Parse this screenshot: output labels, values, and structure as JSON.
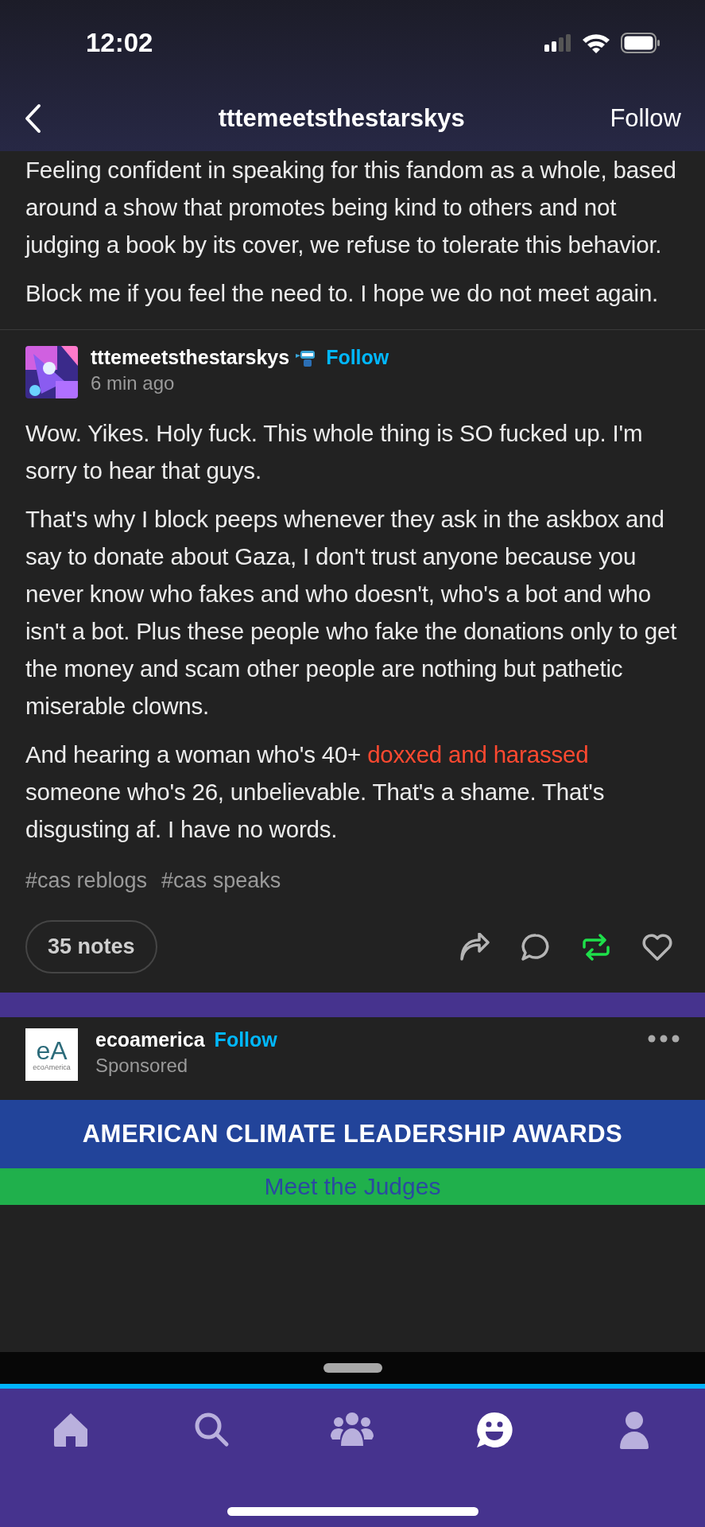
{
  "status_bar": {
    "time": "12:02"
  },
  "header": {
    "title": "tttemeetsthestarskys",
    "follow": "Follow"
  },
  "earlier_post": {
    "paragraphs": [
      "Feeling confident in speaking for this fandom as a whole, based around a show that promotes being kind to others and not judging a book by its cover, we refuse to tolerate this behavior.",
      "Block me if you feel the need to. I hope we do not meet again."
    ]
  },
  "reply": {
    "username": "tttemeetsthestarskys",
    "follow": "Follow",
    "time": "6 min ago",
    "paragraphs": [
      [
        {
          "kind": "text",
          "text": "Wow. Yikes. Holy fuck. This whole thing is SO fucked up. I'm sorry to hear that guys."
        }
      ],
      [
        {
          "kind": "text",
          "text": "That's why I block peeps whenever they ask in the askbox and say to donate about Gaza, I don't trust anyone because you never know who fakes and who doesn't, who's a bot and who isn't a bot. Plus these people who fake the donations only to get the money and scam other people are nothing but pathetic miserable clowns."
        }
      ],
      [
        {
          "kind": "text",
          "text": "And hearing a woman who's 40+ "
        },
        {
          "kind": "link",
          "text": "doxxed and harassed"
        },
        {
          "kind": "text",
          "text": " someone who's 26, unbelievable. That's a shame. That's disgusting af. I have no words."
        }
      ]
    ],
    "tags": [
      "#cas reblogs",
      "#cas speaks"
    ],
    "notes": "35 notes",
    "actions": [
      {
        "kind": "share",
        "on": false
      },
      {
        "kind": "reply",
        "on": false
      },
      {
        "kind": "reblog",
        "on": true
      },
      {
        "kind": "like",
        "on": false
      }
    ]
  },
  "ad": {
    "logo": "eA",
    "logo_caption": "ecoAmerica",
    "name": "ecoamerica",
    "follow": "Follow",
    "label": "Sponsored",
    "banner": "AMERICAN CLIMATE LEADERSHIP AWARDS",
    "cta": "Meet the Judges"
  },
  "tabs": [
    {
      "kind": "home",
      "selected": false
    },
    {
      "kind": "search",
      "selected": false
    },
    {
      "kind": "communities",
      "selected": false
    },
    {
      "kind": "chat",
      "selected": true
    },
    {
      "kind": "account",
      "selected": false
    }
  ]
}
